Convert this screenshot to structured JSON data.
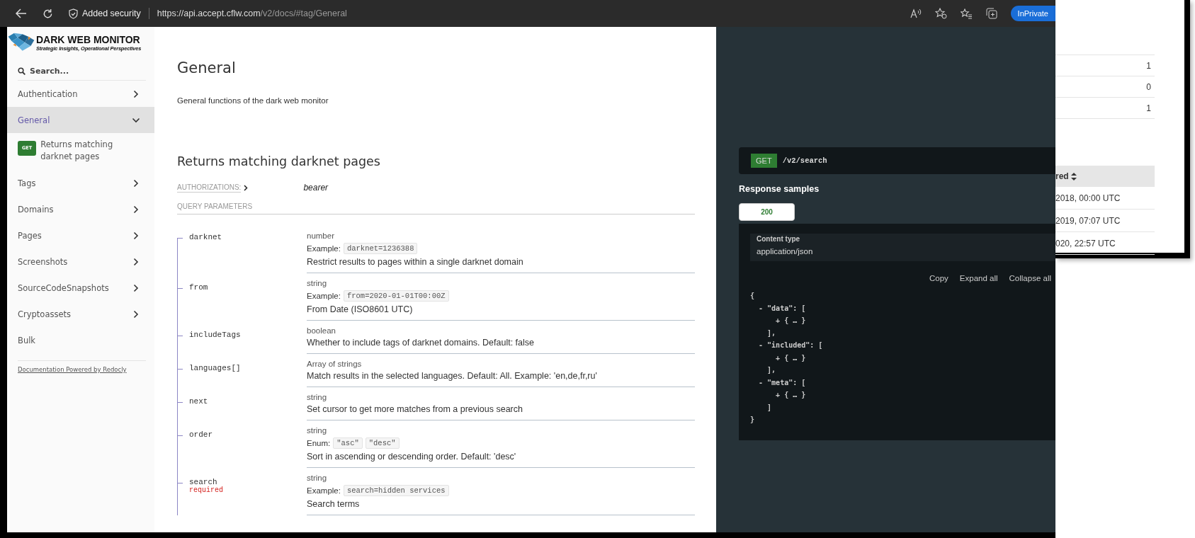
{
  "browser": {
    "security_label": "Added security",
    "url_host": "https://api.accept.cflw.com",
    "url_path": "/v2/docs/#tag/General",
    "profile_badge": "InPrivate"
  },
  "sidebar": {
    "brand_title": "DARK WEB MONITOR",
    "brand_tagline": "Strategic Insights, Operational Perspectives",
    "search": {
      "placeholder": "Search..."
    },
    "items": [
      {
        "label": "Authentication",
        "expandable": true,
        "expanded": false,
        "selected": false
      },
      {
        "label": "General",
        "expandable": true,
        "expanded": true,
        "selected": true,
        "children": [
          {
            "method": "GET",
            "label": "Returns matching darknet pages",
            "selected": false
          }
        ]
      },
      {
        "label": "Tags",
        "expandable": true,
        "expanded": false,
        "selected": false
      },
      {
        "label": "Domains",
        "expandable": true,
        "expanded": false,
        "selected": false
      },
      {
        "label": "Pages",
        "expandable": true,
        "expanded": false,
        "selected": false
      },
      {
        "label": "Screenshots",
        "expandable": true,
        "expanded": false,
        "selected": false
      },
      {
        "label": "SourceCodeSnapshots",
        "expandable": true,
        "expanded": false,
        "selected": false
      },
      {
        "label": "Cryptoassets",
        "expandable": true,
        "expanded": false,
        "selected": false
      },
      {
        "label": "Bulk",
        "expandable": false,
        "selected": false
      }
    ],
    "footer_link": "Documentation Powered by Redocly"
  },
  "main": {
    "title": "General",
    "description": "General functions of the dark web monitor",
    "operation_title": "Returns matching darknet pages",
    "authorizations_label": "AUTHORIZATIONS:",
    "authorization": "bearer",
    "params_heading": "QUERY PARAMETERS",
    "params": [
      {
        "name": "darknet",
        "type": "number",
        "example_label": "Example:",
        "example": "darknet=1236388",
        "description": "Restrict results to pages within a single darknet domain"
      },
      {
        "name": "from",
        "type": "string",
        "example_label": "Example:",
        "example": "from=2020-01-01T00:00Z",
        "description": "From Date (ISO8601 UTC)"
      },
      {
        "name": "includeTags",
        "type": "boolean",
        "description": "Whether to include tags of darknet domains. Default: false"
      },
      {
        "name": "languages[]",
        "type": "Array of strings",
        "description": "Match results in the selected languages. Default: All. Example: 'en,de,fr,ru'"
      },
      {
        "name": "next",
        "type": "string",
        "description": "Set cursor to get more matches from a previous search"
      },
      {
        "name": "order",
        "type": "string",
        "enum_label": "Enum:",
        "enum": [
          "\"asc\"",
          "\"desc\""
        ],
        "description": "Sort in ascending or descending order. Default: 'desc'"
      },
      {
        "name": "search",
        "required_label": "required",
        "type": "string",
        "example_label": "Example:",
        "example": "search=hidden services",
        "description": "Search terms"
      }
    ]
  },
  "right_panel": {
    "method": "GET",
    "path": "/v2/search",
    "samples_heading": "Response samples",
    "tabs": [
      {
        "label": "200",
        "selected": true
      }
    ],
    "content_type_label": "Content type",
    "content_type": "application/json",
    "actions": [
      "Copy",
      "Expand all",
      "Collapse all"
    ],
    "code_lines": [
      "{",
      "  - \"data\": [",
      "      + { … }",
      "    ],",
      "  - \"included\": [",
      "      + { … }",
      "    ],",
      "  - \"meta\": [",
      "      + { … }",
      "    ]",
      "}"
    ]
  },
  "background_window": {
    "counts": [
      "1",
      "0",
      "1"
    ],
    "column_header": "red",
    "dates": [
      "2018, 00:00 UTC",
      "2019, 07:07 UTC",
      "020, 22:57 UTC"
    ]
  }
}
